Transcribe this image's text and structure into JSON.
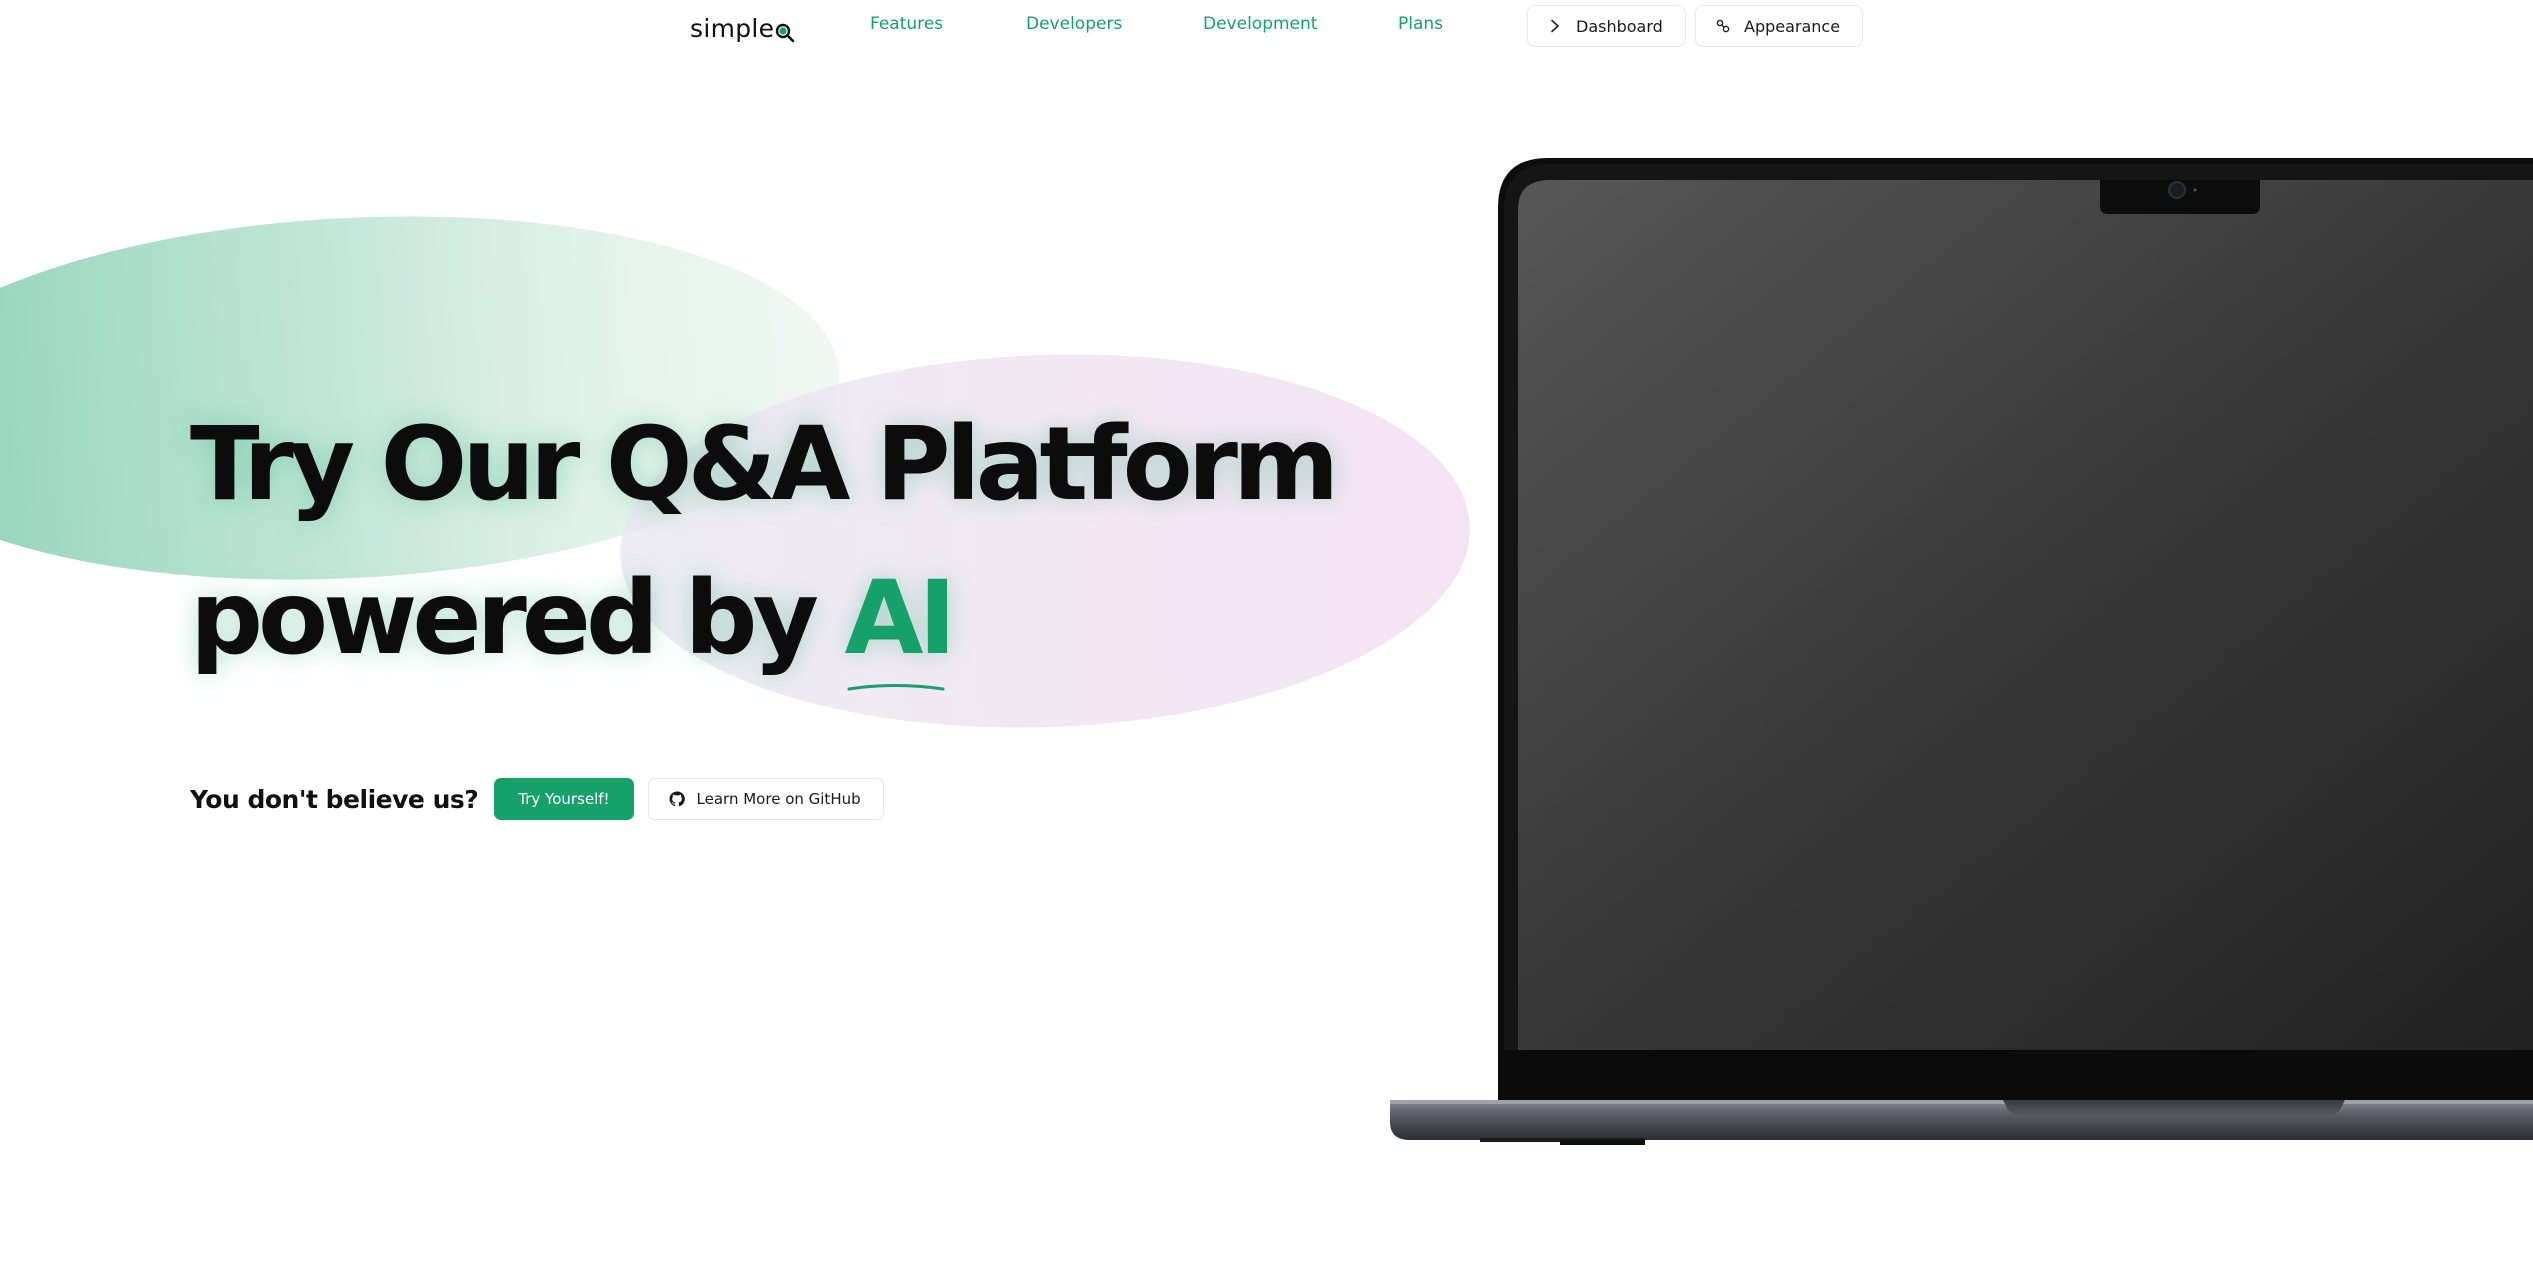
{
  "nav": {
    "logo": "simple",
    "links": [
      "Features",
      "Developers",
      "Development",
      "Plans"
    ],
    "dashboard_label": "Dashboard",
    "appearance_label": "Appearance"
  },
  "hero": {
    "line1": "Try Our Q&A Platform",
    "line2_prefix": "powered by ",
    "line2_accent": "AI",
    "cta_text": "You don't believe us?",
    "try_button": "Try Yourself!",
    "github_button": "Learn More on GitHub"
  },
  "colors": {
    "accent": "#16a06a",
    "text": "#0c0c0c"
  },
  "icons": {
    "logo_mark": "magnifier-icon",
    "dashboard": "chevron-right-icon",
    "appearance": "theme-icon",
    "github": "github-icon"
  }
}
